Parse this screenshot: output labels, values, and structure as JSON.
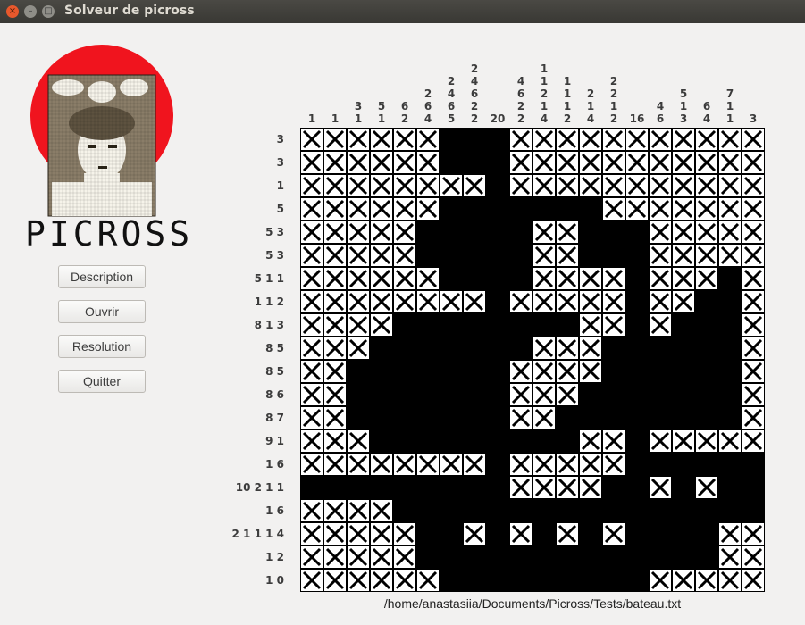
{
  "window": {
    "title": "Solveur de picross",
    "close_glyph": "×",
    "min_glyph": "–",
    "max_glyph": "□"
  },
  "sidebar": {
    "logo_text": "PICROSS",
    "buttons": {
      "description": "Description",
      "open": "Ouvrir",
      "resolution": "Resolution",
      "quit": "Quitter"
    }
  },
  "puzzle": {
    "column_clues": [
      [
        "1"
      ],
      [
        "1"
      ],
      [
        "3",
        "1"
      ],
      [
        "5",
        "1"
      ],
      [
        "6",
        "2"
      ],
      [
        "2",
        "6",
        "4"
      ],
      [
        "2",
        "4",
        "6",
        "5"
      ],
      [
        "2",
        "4",
        "6",
        "2",
        "2"
      ],
      [
        "20"
      ],
      [
        "4",
        "6",
        "2",
        "2"
      ],
      [
        "1",
        "1",
        "2",
        "1",
        "4"
      ],
      [
        "1",
        "1",
        "1",
        "2"
      ],
      [
        "2",
        "1",
        "4"
      ],
      [
        "2",
        "2",
        "1",
        "2"
      ],
      [
        "16"
      ],
      [
        "4",
        "6"
      ],
      [
        "5",
        "1",
        "3"
      ],
      [
        "6",
        "4"
      ],
      [
        "7",
        "1",
        "1"
      ],
      [
        "3"
      ]
    ],
    "row_clues": [
      "3",
      "3",
      "1",
      "5",
      "5 3",
      "5 3",
      "5 1 1",
      "1 1 2",
      "8 1 3",
      "8 5",
      "8 5",
      "8 6",
      "8 7",
      "9 1",
      "1 6",
      "10 2 1 1",
      "1 6",
      "2 1 1 1 4",
      "1 2",
      "1 0"
    ],
    "grid": [
      "XXXXXX...XXXXXXXXXXX",
      "XXXXXX...XXXXXXXXXXX",
      "XXXXXXXX.XXXXXXXXXXX",
      "XXXXXX.......XXXXXXX",
      "XXXXX.....XX...XXXXX",
      "XXXXX.....XX...XXXXX",
      "XXXXXX....XXXX.XXX.X",
      "XXXXXXXX.XXXXX.XX..X",
      "XXXX........XX.X...X",
      "XXX.......XXX......X",
      "XX.......XXXX......X",
      "XX.......XXX.......X",
      "XX.......XX........X",
      "XXX.........XX.XXXXX",
      "XXXXXXXX.XXXXX......",
      ".........XXXX..X.X..",
      "XXXX................",
      "XXXXX..X.X.X.X....XX",
      "XXXXX.............XX",
      "XXXXXX.........XXXXX"
    ]
  },
  "status": {
    "file_path": "/home/anastasiia/Documents/Picross/Tests/bateau.txt"
  },
  "colors": {
    "logo_circle": "#f0141e",
    "filled_cell": "#000000",
    "cross_cell_bg": "#ffffff",
    "portrait_bg": "#8a7d68"
  },
  "icons": {
    "close": "close-icon",
    "minimize": "minimize-icon",
    "maximize": "maximize-icon",
    "cross": "cross-icon"
  }
}
